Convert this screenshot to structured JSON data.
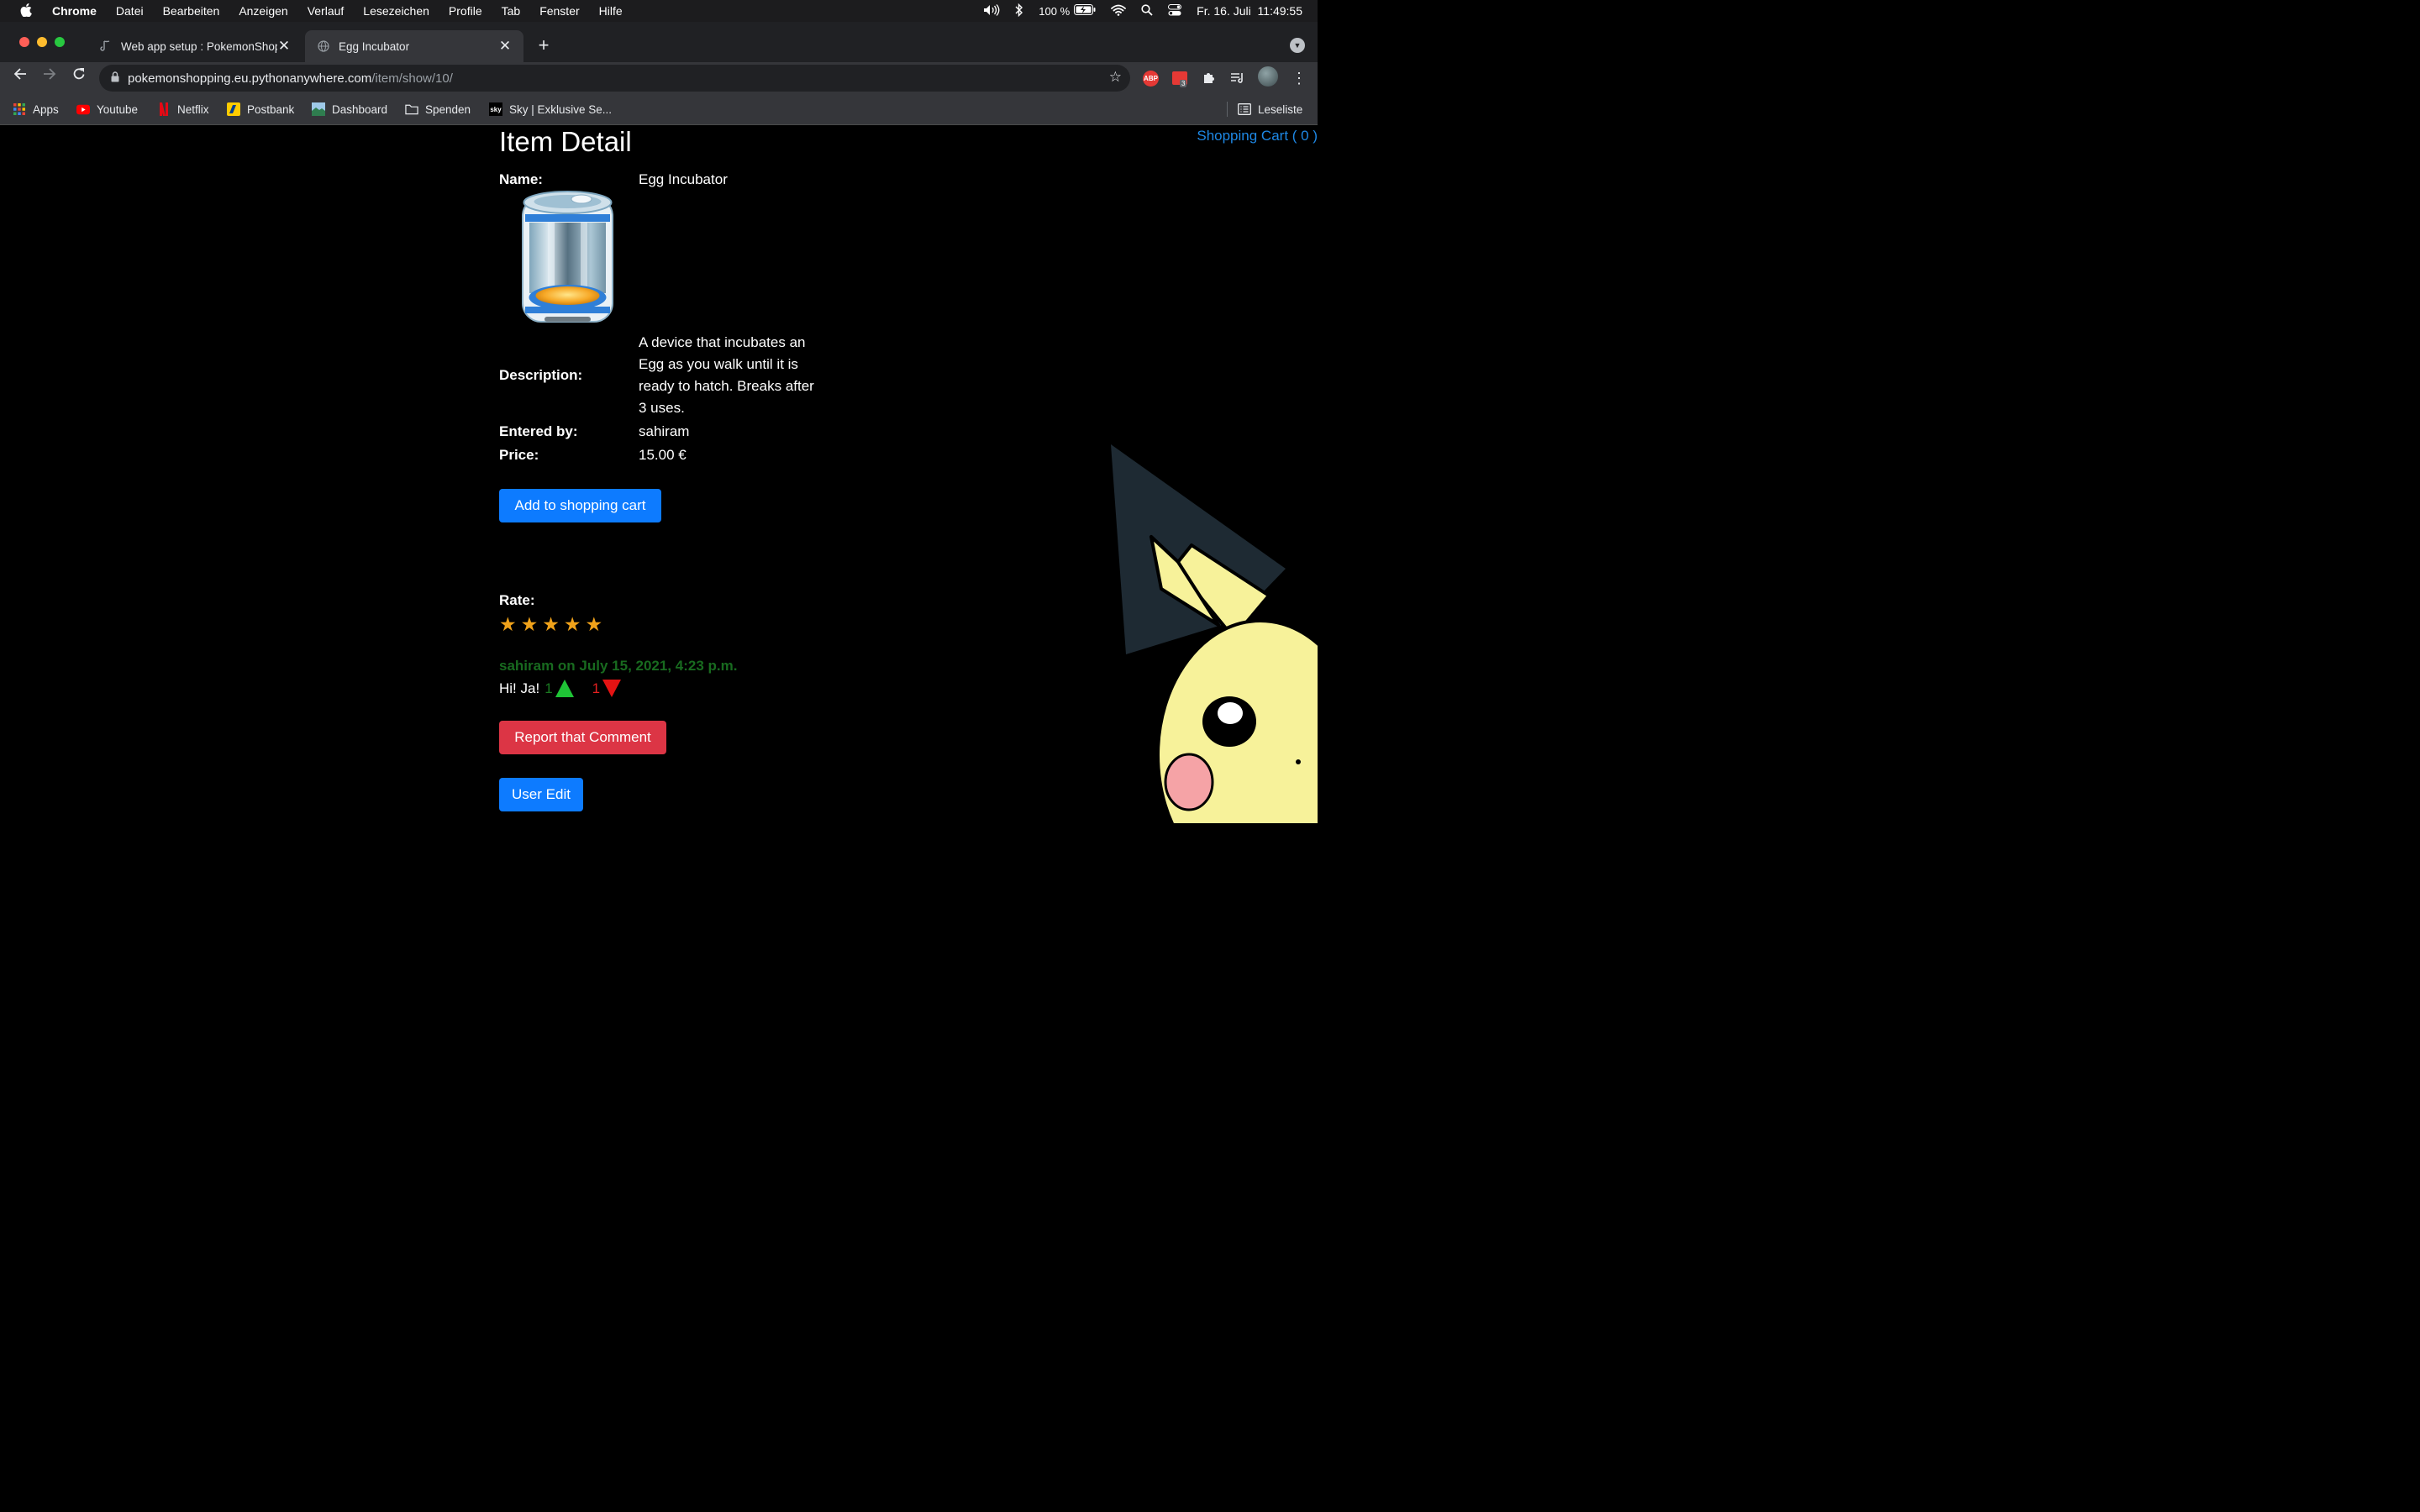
{
  "menubar": {
    "app": "Chrome",
    "items": [
      "Datei",
      "Bearbeiten",
      "Anzeigen",
      "Verlauf",
      "Lesezeichen",
      "Profile",
      "Tab",
      "Fenster",
      "Hilfe"
    ],
    "battery": "100 %",
    "datetime": "Fr. 16. Juli  11:49:55"
  },
  "tabs": {
    "inactive_label": "Web app setup : PokemonShop",
    "active_label": "Egg Incubator"
  },
  "address": {
    "host": "pokemonshopping.eu.pythonanywhere.com",
    "path": "/item/show/10/"
  },
  "extensions": {
    "abp": "ABP",
    "badge": "3"
  },
  "bookmarks": {
    "apps": "Apps",
    "youtube": "Youtube",
    "netflix": "Netflix",
    "postbank": "Postbank",
    "dashboard": "Dashboard",
    "spenden": "Spenden",
    "sky": "Sky | Exklusive Se...",
    "sky_icon": "sky",
    "reading_list": "Leseliste"
  },
  "page": {
    "cart": "Shopping Cart ( 0 )",
    "title": "Item Detail",
    "name_label": "Name:",
    "name": "Egg Incubator",
    "description_label": "Description:",
    "description": "A device that incubates an Egg as you walk until it is ready to hatch. Breaks after 3 uses.",
    "entered_by_label": "Entered by:",
    "entered_by": "sahiram",
    "price_label": "Price:",
    "price": "15.00 €",
    "add_to_cart": "Add to shopping cart",
    "rate_label": "Rate:",
    "rating": 5,
    "star": "★",
    "comment_header": "sahiram on July 15, 2021, 4:23 p.m.",
    "comment_text": "Hi! Ja!",
    "upvotes": "1",
    "downvotes": "1",
    "report_button": "Report that Comment",
    "user_edit_button": "User Edit"
  },
  "colors": {
    "link": "#1e88e5",
    "primary_button": "#0d7bff",
    "danger_button": "#dc3545",
    "comment_author": "#186a1f",
    "upvote": "#1fc436",
    "downvote": "#e51313"
  }
}
